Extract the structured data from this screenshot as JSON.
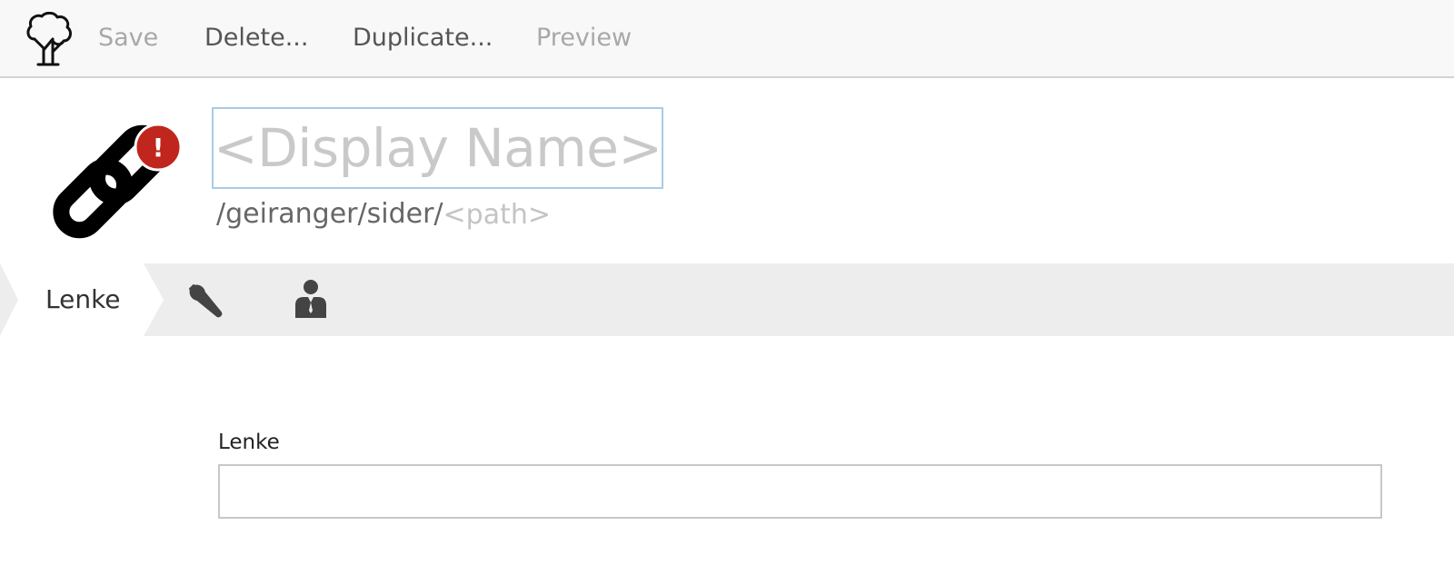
{
  "toolbar": {
    "logo_icon": "tree-logo-icon",
    "save_label": "Save",
    "delete_label": "Delete...",
    "duplicate_label": "Duplicate...",
    "preview_label": "Preview"
  },
  "header": {
    "content_icon": "chain-link-icon",
    "error_badge": "!",
    "error_badge_color": "#c0261d",
    "display_name": {
      "value": "",
      "placeholder": "<Display Name>"
    },
    "path": {
      "prefix": "/geiranger/sider/",
      "value": "",
      "placeholder": "<path>"
    }
  },
  "tabs": {
    "active_label": "Lenke",
    "settings_icon": "wrench-icon",
    "security_icon": "person-icon"
  },
  "form": {
    "link_label": "Lenke",
    "link_value": ""
  },
  "colors": {
    "focus_border": "#a9cbe8",
    "tabbar_background": "#ededed",
    "toolbar_background": "#f8f8f8"
  }
}
